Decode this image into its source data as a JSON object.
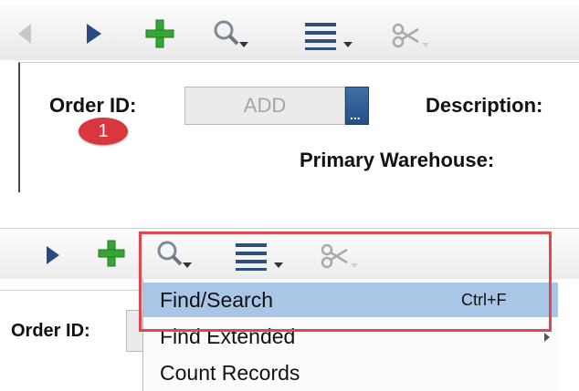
{
  "top_toolbar": {
    "icons": [
      "back-arrow-icon",
      "forward-arrow-icon",
      "add-icon",
      "search-icon",
      "list-icon",
      "scissors-icon"
    ]
  },
  "form": {
    "order_id_label": "Order ID:",
    "order_id_value": "ADD",
    "lookup_dots": "...",
    "description_label": "Description:",
    "primary_warehouse_label": "Primary Warehouse:",
    "step_badge": "1"
  },
  "bottom": {
    "order_id_label": "Order ID:",
    "menu": {
      "items": [
        {
          "label": "Find/Search",
          "shortcut": "Ctrl+F",
          "selected": true
        },
        {
          "label": "Find Extended",
          "shortcut": "",
          "selected": false
        },
        {
          "label": "Count Records",
          "shortcut": "",
          "selected": false
        }
      ]
    }
  },
  "colors": {
    "highlight_border": "#e0464c",
    "menu_selected": "#a9c6e6",
    "nav_blue": "#2a4a80",
    "add_green": "#35a535",
    "badge_red": "#d9363e"
  }
}
